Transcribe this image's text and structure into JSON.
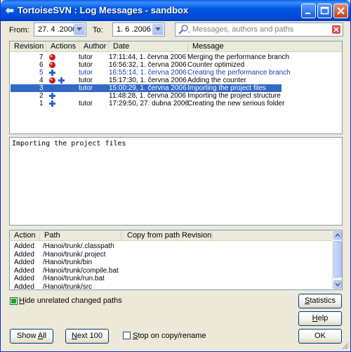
{
  "window": {
    "title": "TortoiseSVN : Log Messages - sandbox"
  },
  "filter": {
    "from_label": "From:",
    "from_date": "27. 4 .2006",
    "to_label": "To:",
    "to_date": "1. 6 .2006",
    "search_placeholder": "Messages, authors and paths"
  },
  "log_list": {
    "columns": [
      "Revision",
      "Actions",
      "Author",
      "Date",
      "Message"
    ],
    "rows": [
      {
        "revision": "7",
        "author": "tutor",
        "date": "17:11:44, 1. června 2006",
        "message": "Merging the performance branch",
        "style": "normal",
        "icons": [
          "modify"
        ]
      },
      {
        "revision": "6",
        "author": "tutor",
        "date": "16:56:32, 1. června 2006",
        "message": "Counter optimized",
        "style": "normal",
        "icons": [
          "modify"
        ]
      },
      {
        "revision": "5",
        "author": "tutor",
        "date": "16:55:14, 1. června 2006",
        "message": "Creating the performance branch",
        "style": "blue",
        "icons": [
          "add"
        ]
      },
      {
        "revision": "4",
        "author": "tutor",
        "date": "15:17:30, 1. června 2006",
        "message": "Adding the counter",
        "style": "normal",
        "icons": [
          "modify",
          "add"
        ]
      },
      {
        "revision": "3",
        "author": "tutor",
        "date": "15:00:29, 1. června 2006",
        "message": "Importing the project files",
        "style": "selected",
        "icons": [
          "add"
        ]
      },
      {
        "revision": "2",
        "author": "",
        "date": "11:48:28, 1. června 2006",
        "message": "Importing the project structure",
        "style": "normal",
        "icons": [
          "add"
        ]
      },
      {
        "revision": "1",
        "author": "tutor",
        "date": "17:29:50, 27. dubna 2006",
        "message": "Creating the new serious folder",
        "style": "normal",
        "icons": [
          "add"
        ]
      }
    ]
  },
  "message_text": "Importing the project files",
  "paths_list": {
    "columns": [
      "Action",
      "Path",
      "Copy from path",
      "Revision"
    ],
    "rows": [
      {
        "action": "Added",
        "path": "/Hanoi/trunk/.classpath"
      },
      {
        "action": "Added",
        "path": "/Hanoi/trunk/.project"
      },
      {
        "action": "Added",
        "path": "/Hanoi/trunk/bin"
      },
      {
        "action": "Added",
        "path": "/Hanoi/trunk/compile.bat"
      },
      {
        "action": "Added",
        "path": "/Hanoi/trunk/run.bat"
      },
      {
        "action": "Added",
        "path": "/Hanoi/trunk/src"
      }
    ]
  },
  "options": {
    "hide_unrelated_label": "Hide unrelated changed paths",
    "hide_unrelated_checked": true,
    "stop_on_copy_label": "Stop on copy/rename",
    "stop_on_copy_checked": false
  },
  "buttons": {
    "statistics": "Statistics",
    "help": "Help",
    "show_all": "Show All",
    "next_100": "Next 100",
    "ok": "OK"
  },
  "colors": {
    "selection": "#316ac5",
    "blue_row": "#1f3cb0",
    "modify_icon": "#d01a1a",
    "add_icon": "#2a62d8"
  }
}
